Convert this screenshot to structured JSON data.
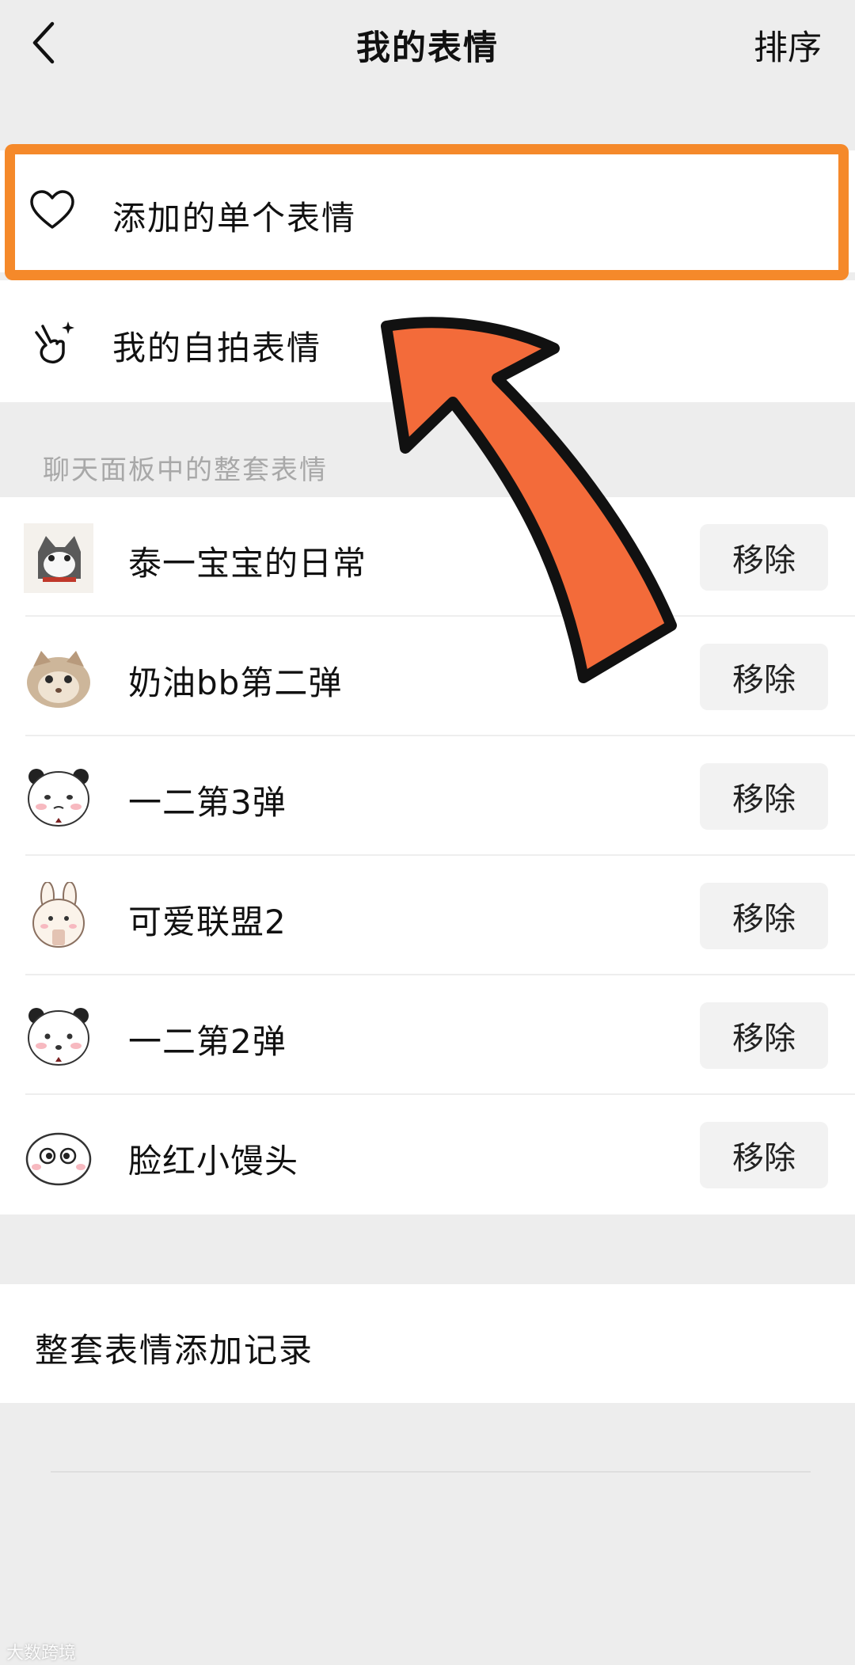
{
  "navbar": {
    "title": "我的表情",
    "sort_label": "排序"
  },
  "top_items": {
    "single": {
      "label": "添加的单个表情",
      "icon": "heart-icon"
    },
    "selfie": {
      "label": "我的自拍表情",
      "icon": "hand-sparkle-icon"
    }
  },
  "section": {
    "header": "聊天面板中的整套表情"
  },
  "packs": [
    {
      "name": "泰一宝宝的日常",
      "button": "移除",
      "icon": "cat-sticker"
    },
    {
      "name": "奶油bb第二弹",
      "button": "移除",
      "icon": "hamster-sticker"
    },
    {
      "name": "一二第3弹",
      "button": "移除",
      "icon": "panda-sticker"
    },
    {
      "name": "可爱联盟2",
      "button": "移除",
      "icon": "bunny-sticker"
    },
    {
      "name": "一二第2弹",
      "button": "移除",
      "icon": "panda-sticker"
    },
    {
      "name": "脸红小馒头",
      "button": "移除",
      "icon": "bun-sticker"
    }
  ],
  "record": {
    "label": "整套表情添加记录"
  },
  "watermark": "大数跨境",
  "colors": {
    "highlight": "#f5892a",
    "arrow": "#f36b3a",
    "background": "#ededed"
  }
}
